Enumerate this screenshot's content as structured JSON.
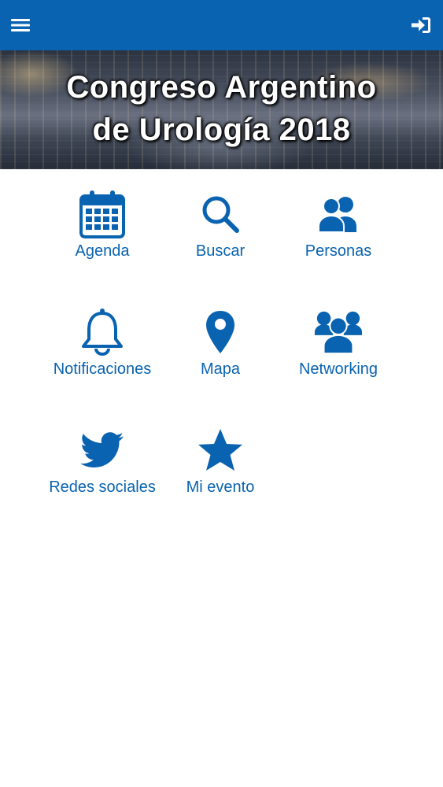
{
  "header": {
    "menu_icon": "hamburger-menu-icon",
    "login_icon": "sign-in-icon",
    "color": "#0a63b0"
  },
  "banner": {
    "title_line1": "Congreso Argentino",
    "title_line2": "de Urología 2018"
  },
  "menu": {
    "items": [
      {
        "label": "Agenda",
        "icon": "calendar-icon"
      },
      {
        "label": "Buscar",
        "icon": "search-icon"
      },
      {
        "label": "Personas",
        "icon": "users-icon"
      },
      {
        "label": "Notificaciones",
        "icon": "bell-icon"
      },
      {
        "label": "Mapa",
        "icon": "map-marker-icon"
      },
      {
        "label": "Networking",
        "icon": "group-icon"
      },
      {
        "label": "Redes sociales",
        "icon": "twitter-icon"
      },
      {
        "label": "Mi evento",
        "icon": "star-icon"
      }
    ],
    "accent_color": "#0a63b0"
  }
}
